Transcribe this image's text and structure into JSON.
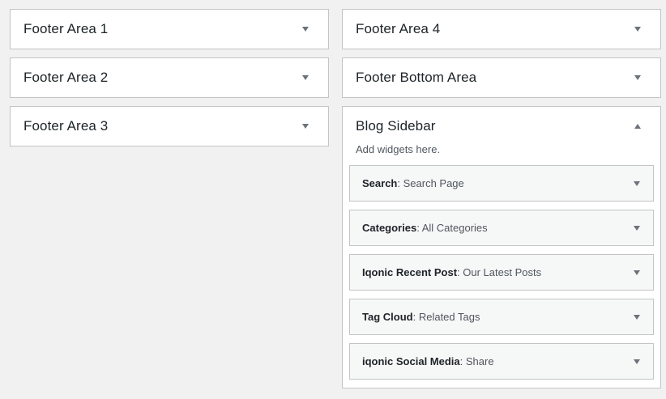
{
  "left_areas": [
    {
      "title": "Footer Area 1"
    },
    {
      "title": "Footer Area 2"
    },
    {
      "title": "Footer Area 3"
    }
  ],
  "right_areas": [
    {
      "title": "Footer Area 4"
    },
    {
      "title": "Footer Bottom Area"
    }
  ],
  "blog_sidebar": {
    "title": "Blog Sidebar",
    "description": "Add widgets here.",
    "widgets": [
      {
        "name": "Search",
        "separator": ": ",
        "subtitle": "Search Page"
      },
      {
        "name": "Categories",
        "separator": ": ",
        "subtitle": "All Categories"
      },
      {
        "name": "Iqonic Recent Post",
        "separator": ": ",
        "subtitle": "Our Latest Posts"
      },
      {
        "name": "Tag Cloud",
        "separator": ": ",
        "subtitle": "Related Tags"
      },
      {
        "name": "iqonic Social Media",
        "separator": ": ",
        "subtitle": "Share"
      }
    ]
  },
  "colors": {
    "background": "#f1f1f1",
    "panel": "#ffffff",
    "widget_bg": "#f6f7f7",
    "border": "#c3c4c7",
    "arrow": "#6c7278"
  },
  "icons": {
    "collapsed": "triangle-down",
    "expanded": "triangle-up"
  }
}
